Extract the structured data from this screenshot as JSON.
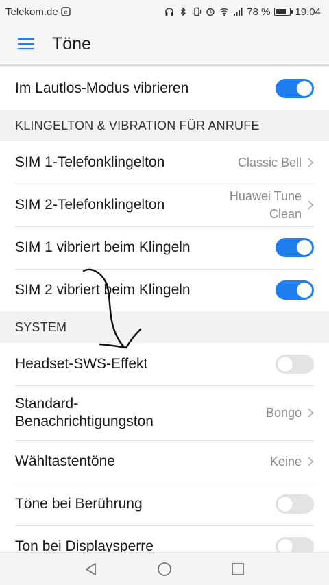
{
  "status_bar": {
    "carrier": "Telekom.de",
    "battery_percent": "78 %",
    "battery_level": 0.78,
    "time": "19:04"
  },
  "app_bar": {
    "title": "Töne"
  },
  "rows": {
    "silent_vibrate": {
      "label": "Im Lautlos-Modus vibrieren",
      "enabled": true
    },
    "section_ringtone": "KLINGELTON & VIBRATION FÜR ANRUFE",
    "sim1_ringtone": {
      "label": "SIM 1-Telefonklingelton",
      "value": "Classic Bell"
    },
    "sim2_ringtone": {
      "label": "SIM 2-Telefonklingelton",
      "value_line1": "Huawei Tune",
      "value_line2": "Clean"
    },
    "sim1_vibrate": {
      "label": "SIM 1 vibriert beim Klingeln",
      "enabled": true
    },
    "sim2_vibrate": {
      "label": "SIM 2 vibriert beim Klingeln",
      "enabled": true
    },
    "section_system": "SYSTEM",
    "headset_sws": {
      "label": "Headset-SWS-Effekt",
      "enabled": false
    },
    "notification_tone": {
      "label_line1": "Standard-",
      "label_line2": "Benachrichtigungston",
      "value": "Bongo"
    },
    "dial_tones": {
      "label": "Wähltastentöne",
      "value": "Keine"
    },
    "touch_tones": {
      "label": "Töne bei Berührung",
      "enabled": false
    },
    "lock_tone": {
      "label": "Ton bei Displaysperre",
      "enabled": false
    }
  },
  "colors": {
    "accent": "#1f7ef0",
    "toggle_off": "#e3e3e3",
    "text": "#1a1a1a",
    "secondary": "#8a8a8a"
  }
}
